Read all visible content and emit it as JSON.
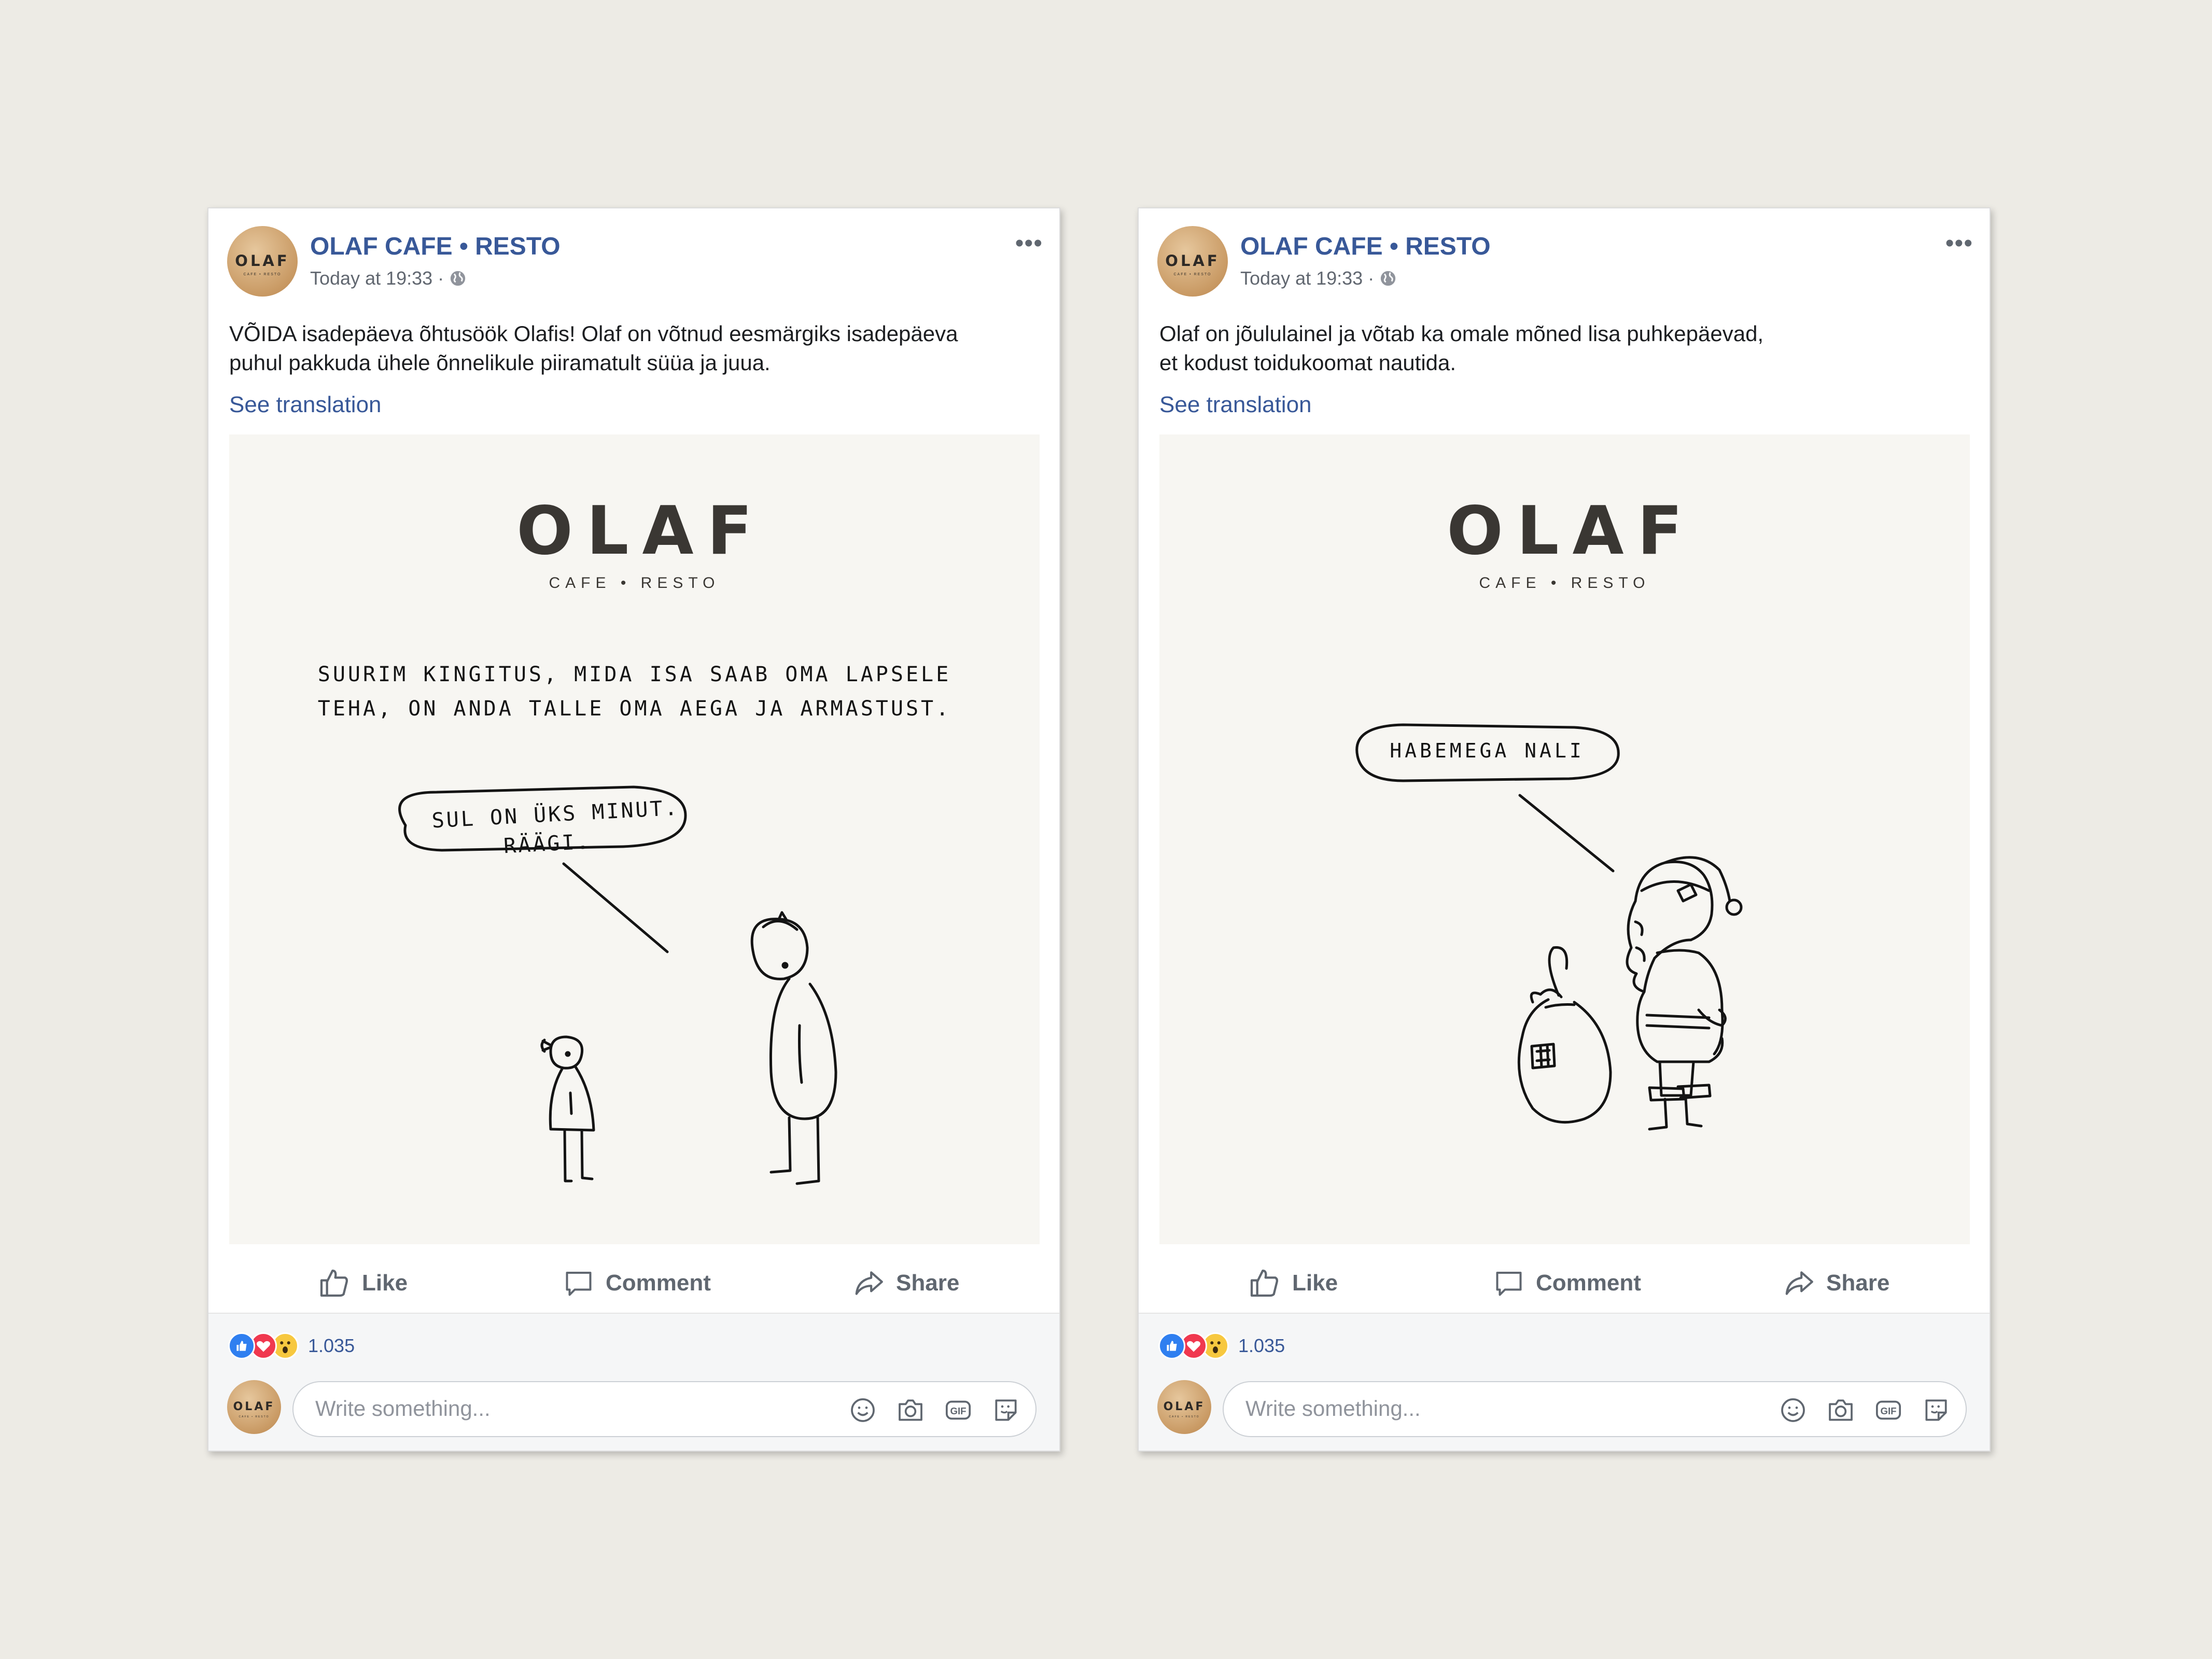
{
  "posts": [
    {
      "page_name": "OLAF CAFE • RESTO",
      "timestamp": "Today at 19:33 ·",
      "text_lines": [
        "VÕIDA isadepäeva õhtusöök Olafis! Olaf on võtnud eesmärgiks isadepäeva",
        "puhul pakkuda ühele õnnelikule piiramatult süüa ja juua."
      ],
      "see_translation": "See translation",
      "image": {
        "logo": "OLAF",
        "logo_sub": "CAFE • RESTO",
        "caption_lines": [
          "SUURIM KINGITUS, MIDA ISA SAAB OMA LAPSELE",
          "TEHA, ON ANDA TALLE OMA AEGA JA ARMASTUST."
        ],
        "bubble_lines": [
          "SUL ON ÜKS MINUT.",
          "RÄÄGI."
        ]
      },
      "actions": {
        "like": "Like",
        "comment": "Comment",
        "share": "Share"
      },
      "reaction_count": "1.035",
      "write_placeholder": "Write something...",
      "avatar_text": "OLAF",
      "avatar_sub": "CAFE • RESTO"
    },
    {
      "page_name": "OLAF CAFE • RESTO",
      "timestamp": "Today at 19:33 ·",
      "text_lines": [
        "Olaf on jõululainel ja võtab ka omale mõned lisa puhkepäevad,",
        "et kodust toidukoomat nautida."
      ],
      "see_translation": "See translation",
      "image": {
        "logo": "OLAF",
        "logo_sub": "CAFE • RESTO",
        "bubble_lines": [
          "HABEMEGA NALI"
        ]
      },
      "actions": {
        "like": "Like",
        "comment": "Comment",
        "share": "Share"
      },
      "reaction_count": "1.035",
      "write_placeholder": "Write something...",
      "avatar_text": "OLAF",
      "avatar_sub": "CAFE • RESTO"
    }
  ],
  "icons": [
    "globe-icon",
    "more-options-icon",
    "thumbs-up-icon",
    "comment-icon",
    "share-arrow-icon",
    "like-reaction-icon",
    "love-reaction-icon",
    "wow-reaction-icon",
    "emoji-icon",
    "camera-icon",
    "gif-icon",
    "sticker-icon"
  ],
  "colors": {
    "link_blue": "#385898",
    "background": "#edebe5",
    "image_bg": "#f7f6f2",
    "like_blue": "#2f7ff0",
    "love_red": "#f0384f",
    "wow_yellow": "#f7c83f"
  }
}
